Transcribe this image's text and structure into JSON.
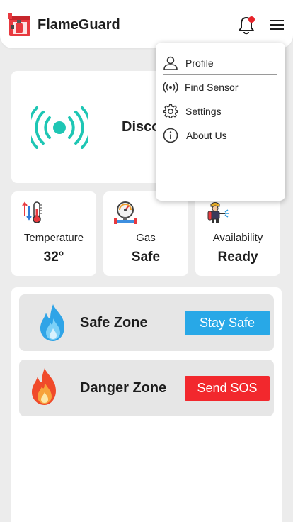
{
  "header": {
    "title": "FlameGuard"
  },
  "status": {
    "text": "Disco"
  },
  "stats": [
    {
      "label": "Temperature",
      "value": "32°",
      "icon": "thermometer-icon"
    },
    {
      "label": "Gas",
      "value": "Safe",
      "icon": "gas-gauge-icon"
    },
    {
      "label": "Availability",
      "value": "Ready",
      "icon": "firefighter-icon"
    }
  ],
  "zones": [
    {
      "title": "Safe Zone",
      "button": "Stay Safe",
      "icon": "blue-flame-icon",
      "button_color": "#28a8e7"
    },
    {
      "title": "Danger Zone",
      "button": "Send SOS",
      "icon": "red-flame-icon",
      "button_color": "#f2282d"
    }
  ],
  "menu": {
    "items": [
      {
        "label": "Profile",
        "icon": "user-icon"
      },
      {
        "label": "Find Sensor",
        "icon": "signal-icon"
      },
      {
        "label": "Settings",
        "icon": "gear-icon"
      },
      {
        "label": "About Us",
        "icon": "info-icon"
      }
    ]
  },
  "colors": {
    "accent": "#1ec6b4",
    "notification": "#e8232a"
  }
}
